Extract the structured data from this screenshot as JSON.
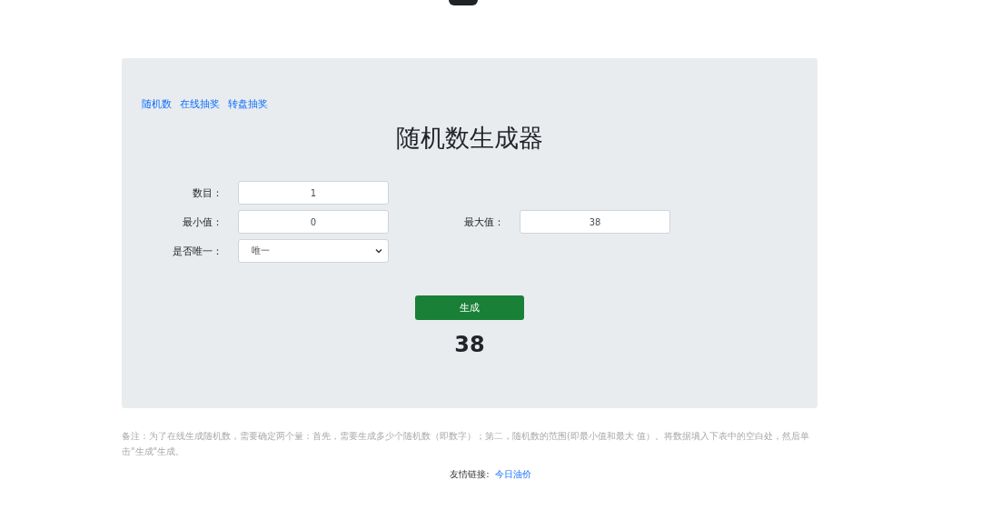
{
  "nav_links": [
    "随机数",
    "在线抽奖",
    "转盘抽奖"
  ],
  "title": "随机数生成器",
  "fields": [
    {
      "label": "数目：",
      "value": "1"
    },
    {
      "label": "最小值：",
      "value": "0"
    },
    {
      "label": "最大值：",
      "value": "38"
    }
  ],
  "unique": {
    "label": "是否唯一：",
    "value": "唯一"
  },
  "generate_button": "生成",
  "result": "38",
  "note": "备注：为了在线生成随机数，需要确定两个量：首先，需要生成多少个随机数（即数字）；第二，随机数的范围(即最小值和最大 值）。将数据填入下表中的空白处，然后单击\"生成\"生成。",
  "footer": {
    "label": "友情链接:",
    "link": "今日油价"
  }
}
